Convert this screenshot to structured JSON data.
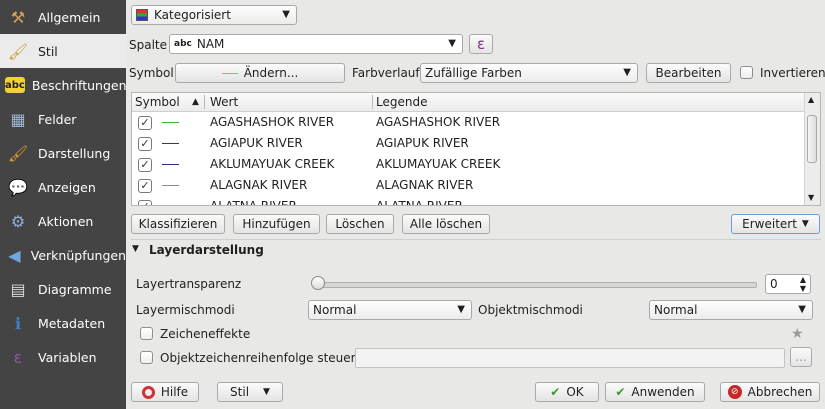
{
  "sidebar": {
    "items": [
      {
        "label": "Allgemein",
        "icon": "wrench-icon"
      },
      {
        "label": "Stil",
        "icon": "paintbrush-icon"
      },
      {
        "label": "Beschriftungen",
        "icon": "abc-label-icon"
      },
      {
        "label": "Felder",
        "icon": "table-icon"
      },
      {
        "label": "Darstellung",
        "icon": "brush-icon"
      },
      {
        "label": "Anzeigen",
        "icon": "speech-bubble-icon"
      },
      {
        "label": "Aktionen",
        "icon": "gear-icon"
      },
      {
        "label": "Verknüpfungen",
        "icon": "join-icon"
      },
      {
        "label": "Diagramme",
        "icon": "chart-icon"
      },
      {
        "label": "Metadaten",
        "icon": "info-icon"
      },
      {
        "label": "Variablen",
        "icon": "epsilon-icon"
      }
    ],
    "active_index": 1
  },
  "renderer": {
    "selected": "Kategorisiert"
  },
  "spalte": {
    "label": "Spalte",
    "type_badge": "abc",
    "value": "NAM",
    "expr_symbol": "ε"
  },
  "symbol_row": {
    "symbol_label": "Symbol",
    "change_button": "Ändern...",
    "ramp_label": "Farbverlauf",
    "ramp_value": "Zufällige Farben",
    "edit_button": "Bearbeiten",
    "invert_label": "Invertieren"
  },
  "table": {
    "headers": {
      "symbol": "Symbol",
      "wert": "Wert",
      "legende": "Legende"
    },
    "rows": [
      {
        "checked": true,
        "color": "#2fb83a",
        "value": "AGASHASHOK RIVER",
        "legend": "AGASHASHOK RIVER"
      },
      {
        "checked": true,
        "color": "#3b2f7a",
        "value": "AGIAPUK RIVER",
        "legend": "AGIAPUK RIVER"
      },
      {
        "checked": true,
        "color": "#2a2f8f",
        "value": "AKLUMAYUAK CREEK",
        "legend": "AKLUMAYUAK CREEK"
      },
      {
        "checked": true,
        "color": "#8a8aa0",
        "value": "ALAGNAK RIVER",
        "legend": "ALAGNAK RIVER"
      },
      {
        "checked": true,
        "color": "#3a3a3a",
        "value": "ALATNA RIVER",
        "legend": "ALATNA RIVER"
      }
    ]
  },
  "actions": {
    "classify": "Klassifizieren",
    "add": "Hinzufügen",
    "delete": "Löschen",
    "delete_all": "Alle löschen",
    "advanced": "Erweitert"
  },
  "layer_rendering": {
    "title": "Layerdarstellung",
    "transparency_label": "Layertransparenz",
    "transparency_value": "0",
    "blend_label": "Layermischmodi",
    "blend_value": "Normal",
    "feature_blend_label": "Objektmischmodi",
    "feature_blend_value": "Normal",
    "effects_label": "Zeicheneffekte",
    "order_label": "Objektzeichenreihenfolge steuern",
    "ellipsis": "..."
  },
  "footer": {
    "help": "Hilfe",
    "style": "Stil",
    "ok": "OK",
    "apply": "Anwenden",
    "cancel": "Abbrechen"
  }
}
